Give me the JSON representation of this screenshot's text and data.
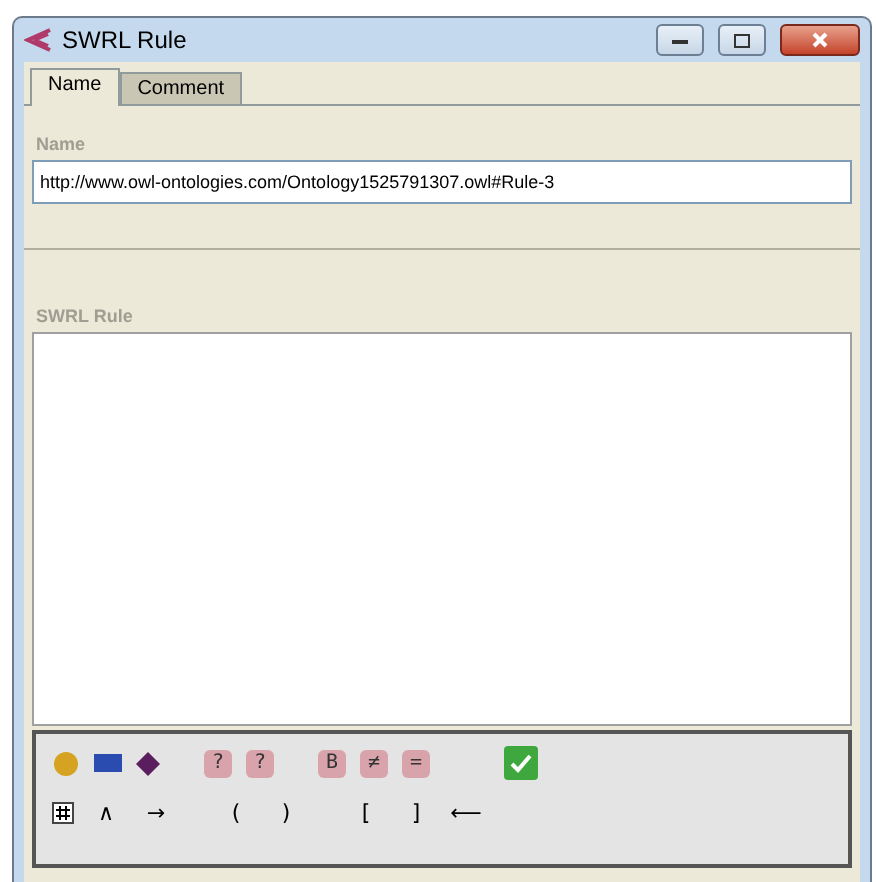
{
  "window": {
    "title": "SWRL Rule"
  },
  "tabs": [
    {
      "label": "Name",
      "selected": true
    },
    {
      "label": "Comment",
      "selected": false
    }
  ],
  "name": {
    "label": "Name",
    "value": "http://www.owl-ontologies.com/Ontology1525791307.owl#Rule-3"
  },
  "rule": {
    "label": "SWRL Rule"
  },
  "toolbar_row_1": [
    {
      "kind": "circle"
    },
    {
      "kind": "rect"
    },
    {
      "kind": "diamond"
    },
    {
      "kind": "gap"
    },
    {
      "kind": "pink",
      "text": "?"
    },
    {
      "kind": "pink",
      "text": "?"
    },
    {
      "kind": "gap"
    },
    {
      "kind": "pink",
      "text": "B"
    },
    {
      "kind": "pink",
      "text": "≠"
    },
    {
      "kind": "pink",
      "text": "="
    },
    {
      "kind": "gap"
    },
    {
      "kind": "gap"
    },
    {
      "kind": "check"
    }
  ],
  "toolbar_row_2": [
    {
      "kind": "grid"
    },
    {
      "kind": "plain",
      "text": "∧"
    },
    {
      "kind": "plain",
      "text": "→"
    },
    {
      "kind": "gap"
    },
    {
      "kind": "plain",
      "text": "("
    },
    {
      "kind": "plain",
      "text": ")"
    },
    {
      "kind": "gap"
    },
    {
      "kind": "plain",
      "text": "["
    },
    {
      "kind": "plain",
      "text": "]"
    },
    {
      "kind": "plain",
      "text": "⟵"
    }
  ]
}
